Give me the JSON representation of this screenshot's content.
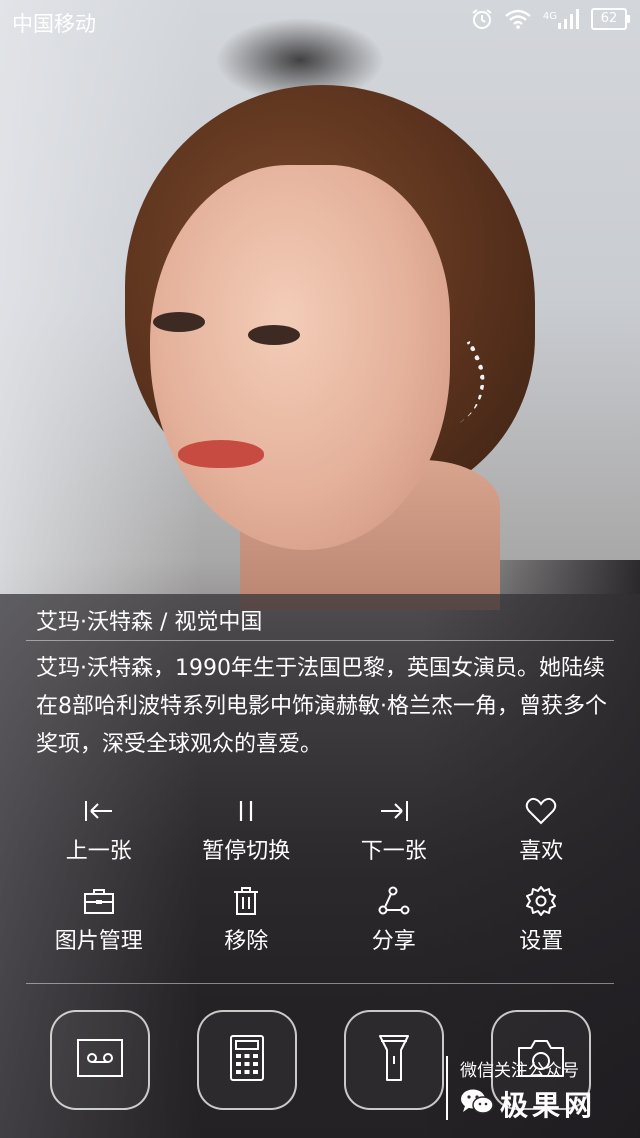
{
  "status_bar": {
    "carrier": "中国移动",
    "network": "4G",
    "battery": "62",
    "icons": [
      "alarm-icon",
      "wifi-icon",
      "signal-icon",
      "battery-icon"
    ]
  },
  "photo": {
    "caption": "艾玛·沃特森 / 视觉中国",
    "description": "艾玛·沃特森，1990年生于法国巴黎，英国女演员。她陆续在8部哈利波特系列电影中饰演赫敏·格兰杰一角，曾获多个奖项，深受全球观众的喜爱。"
  },
  "actions": [
    {
      "label": "上一张",
      "icon": "previous-icon"
    },
    {
      "label": "暂停切换",
      "icon": "pause-icon"
    },
    {
      "label": "下一张",
      "icon": "next-icon"
    },
    {
      "label": "喜欢",
      "icon": "heart-icon"
    },
    {
      "label": "图片管理",
      "icon": "briefcase-icon"
    },
    {
      "label": "移除",
      "icon": "trash-icon"
    },
    {
      "label": "分享",
      "icon": "share-icon"
    },
    {
      "label": "设置",
      "icon": "gear-icon"
    }
  ],
  "shortcuts": [
    {
      "icon": "recorder-icon"
    },
    {
      "icon": "calculator-icon"
    },
    {
      "icon": "flashlight-icon"
    },
    {
      "icon": "camera-icon"
    }
  ],
  "watermark": {
    "top_text": "微信关注公众号",
    "brand": "极果网"
  },
  "colors": {
    "text": "#ffffff",
    "panel": "#2c2a2e"
  }
}
